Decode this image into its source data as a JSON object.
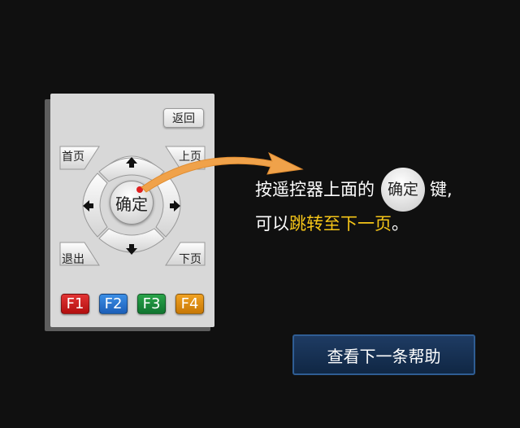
{
  "remote": {
    "back_label": "返回",
    "home_label": "首页",
    "page_up_label": "上页",
    "exit_label": "退出",
    "page_down_label": "下页",
    "ok_label": "确定",
    "function_keys": [
      {
        "label": "F1",
        "color": "#d21f1f"
      },
      {
        "label": "F2",
        "color": "#2b79d6"
      },
      {
        "label": "F3",
        "color": "#1f8c3c"
      },
      {
        "label": "F4",
        "color": "#e08c10"
      }
    ],
    "arrow_color": "#f0a24a"
  },
  "instruction": {
    "part1": "按遥控器上面的",
    "ok_key": "确定",
    "part2": "键,",
    "part3": "可以",
    "highlight": "跳转至下一页",
    "part4": "。",
    "highlight_color": "#f5c518"
  },
  "next_help_button": "查看下一条帮助"
}
